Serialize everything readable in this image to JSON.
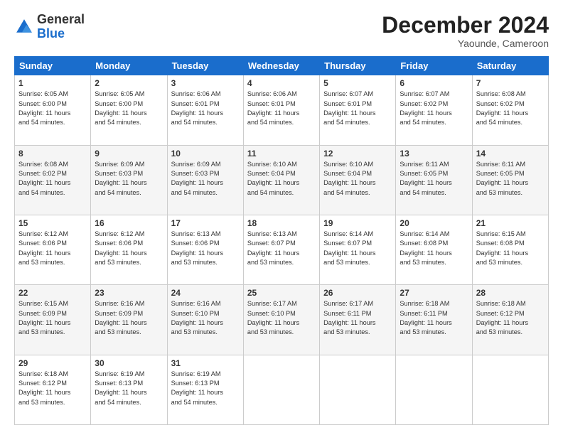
{
  "logo": {
    "general": "General",
    "blue": "Blue"
  },
  "header": {
    "month": "December 2024",
    "location": "Yaounde, Cameroon"
  },
  "weekdays": [
    "Sunday",
    "Monday",
    "Tuesday",
    "Wednesday",
    "Thursday",
    "Friday",
    "Saturday"
  ],
  "weeks": [
    [
      {
        "day": "1",
        "info": "Sunrise: 6:05 AM\nSunset: 6:00 PM\nDaylight: 11 hours\nand 54 minutes."
      },
      {
        "day": "2",
        "info": "Sunrise: 6:05 AM\nSunset: 6:00 PM\nDaylight: 11 hours\nand 54 minutes."
      },
      {
        "day": "3",
        "info": "Sunrise: 6:06 AM\nSunset: 6:01 PM\nDaylight: 11 hours\nand 54 minutes."
      },
      {
        "day": "4",
        "info": "Sunrise: 6:06 AM\nSunset: 6:01 PM\nDaylight: 11 hours\nand 54 minutes."
      },
      {
        "day": "5",
        "info": "Sunrise: 6:07 AM\nSunset: 6:01 PM\nDaylight: 11 hours\nand 54 minutes."
      },
      {
        "day": "6",
        "info": "Sunrise: 6:07 AM\nSunset: 6:02 PM\nDaylight: 11 hours\nand 54 minutes."
      },
      {
        "day": "7",
        "info": "Sunrise: 6:08 AM\nSunset: 6:02 PM\nDaylight: 11 hours\nand 54 minutes."
      }
    ],
    [
      {
        "day": "8",
        "info": "Sunrise: 6:08 AM\nSunset: 6:02 PM\nDaylight: 11 hours\nand 54 minutes."
      },
      {
        "day": "9",
        "info": "Sunrise: 6:09 AM\nSunset: 6:03 PM\nDaylight: 11 hours\nand 54 minutes."
      },
      {
        "day": "10",
        "info": "Sunrise: 6:09 AM\nSunset: 6:03 PM\nDaylight: 11 hours\nand 54 minutes."
      },
      {
        "day": "11",
        "info": "Sunrise: 6:10 AM\nSunset: 6:04 PM\nDaylight: 11 hours\nand 54 minutes."
      },
      {
        "day": "12",
        "info": "Sunrise: 6:10 AM\nSunset: 6:04 PM\nDaylight: 11 hours\nand 54 minutes."
      },
      {
        "day": "13",
        "info": "Sunrise: 6:11 AM\nSunset: 6:05 PM\nDaylight: 11 hours\nand 54 minutes."
      },
      {
        "day": "14",
        "info": "Sunrise: 6:11 AM\nSunset: 6:05 PM\nDaylight: 11 hours\nand 53 minutes."
      }
    ],
    [
      {
        "day": "15",
        "info": "Sunrise: 6:12 AM\nSunset: 6:06 PM\nDaylight: 11 hours\nand 53 minutes."
      },
      {
        "day": "16",
        "info": "Sunrise: 6:12 AM\nSunset: 6:06 PM\nDaylight: 11 hours\nand 53 minutes."
      },
      {
        "day": "17",
        "info": "Sunrise: 6:13 AM\nSunset: 6:06 PM\nDaylight: 11 hours\nand 53 minutes."
      },
      {
        "day": "18",
        "info": "Sunrise: 6:13 AM\nSunset: 6:07 PM\nDaylight: 11 hours\nand 53 minutes."
      },
      {
        "day": "19",
        "info": "Sunrise: 6:14 AM\nSunset: 6:07 PM\nDaylight: 11 hours\nand 53 minutes."
      },
      {
        "day": "20",
        "info": "Sunrise: 6:14 AM\nSunset: 6:08 PM\nDaylight: 11 hours\nand 53 minutes."
      },
      {
        "day": "21",
        "info": "Sunrise: 6:15 AM\nSunset: 6:08 PM\nDaylight: 11 hours\nand 53 minutes."
      }
    ],
    [
      {
        "day": "22",
        "info": "Sunrise: 6:15 AM\nSunset: 6:09 PM\nDaylight: 11 hours\nand 53 minutes."
      },
      {
        "day": "23",
        "info": "Sunrise: 6:16 AM\nSunset: 6:09 PM\nDaylight: 11 hours\nand 53 minutes."
      },
      {
        "day": "24",
        "info": "Sunrise: 6:16 AM\nSunset: 6:10 PM\nDaylight: 11 hours\nand 53 minutes."
      },
      {
        "day": "25",
        "info": "Sunrise: 6:17 AM\nSunset: 6:10 PM\nDaylight: 11 hours\nand 53 minutes."
      },
      {
        "day": "26",
        "info": "Sunrise: 6:17 AM\nSunset: 6:11 PM\nDaylight: 11 hours\nand 53 minutes."
      },
      {
        "day": "27",
        "info": "Sunrise: 6:18 AM\nSunset: 6:11 PM\nDaylight: 11 hours\nand 53 minutes."
      },
      {
        "day": "28",
        "info": "Sunrise: 6:18 AM\nSunset: 6:12 PM\nDaylight: 11 hours\nand 53 minutes."
      }
    ],
    [
      {
        "day": "29",
        "info": "Sunrise: 6:18 AM\nSunset: 6:12 PM\nDaylight: 11 hours\nand 53 minutes."
      },
      {
        "day": "30",
        "info": "Sunrise: 6:19 AM\nSunset: 6:13 PM\nDaylight: 11 hours\nand 54 minutes."
      },
      {
        "day": "31",
        "info": "Sunrise: 6:19 AM\nSunset: 6:13 PM\nDaylight: 11 hours\nand 54 minutes."
      },
      {
        "day": "",
        "info": ""
      },
      {
        "day": "",
        "info": ""
      },
      {
        "day": "",
        "info": ""
      },
      {
        "day": "",
        "info": ""
      }
    ]
  ]
}
